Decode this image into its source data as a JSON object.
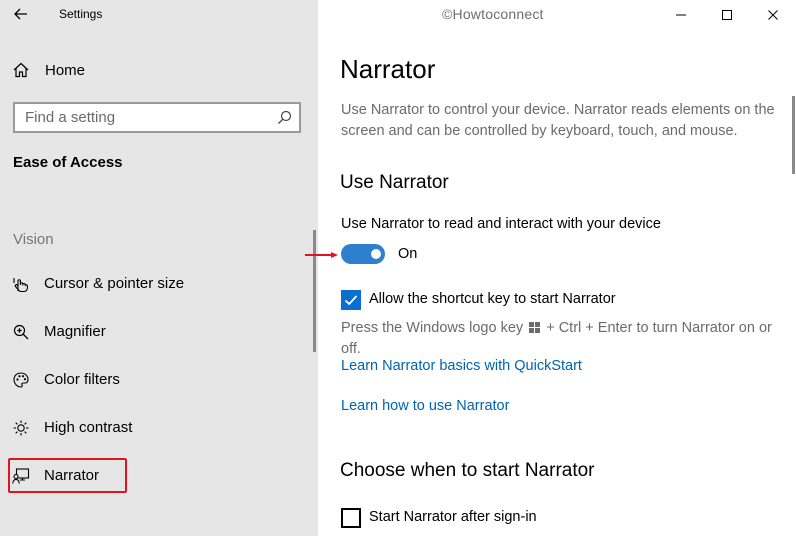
{
  "window": {
    "app_title": "Settings",
    "watermark": "©Howtoconnect"
  },
  "sidebar": {
    "home_label": "Home",
    "search_placeholder": "Find a setting",
    "section_title": "Ease of Access",
    "group_label": "Vision",
    "items": [
      {
        "label": "Cursor & pointer size",
        "icon": "cursor-pointer-icon"
      },
      {
        "label": "Magnifier",
        "icon": "magnifier-icon"
      },
      {
        "label": "Color filters",
        "icon": "palette-icon"
      },
      {
        "label": "High contrast",
        "icon": "brightness-icon"
      },
      {
        "label": "Narrator",
        "icon": "narrator-icon",
        "selected": true
      }
    ]
  },
  "main": {
    "title": "Narrator",
    "description": "Use Narrator to control your device. Narrator reads elements on the screen and can be controlled by keyboard, touch, and mouse.",
    "use_section": {
      "heading": "Use Narrator",
      "toggle_label": "Use Narrator to read and interact with your device",
      "toggle_state": "On",
      "toggle_on": true,
      "shortcut_checkbox_label": "Allow the shortcut key to start Narrator",
      "shortcut_checked": true,
      "hint_prefix": "Press the Windows logo key",
      "hint_suffix": "+ Ctrl + Enter to turn Narrator on or off.",
      "link_quickstart": "Learn Narrator basics with QuickStart",
      "link_howto": "Learn how to use Narrator"
    },
    "start_section": {
      "heading": "Choose when to start Narrator",
      "signin_checkbox_label": "Start Narrator after sign-in",
      "signin_checked": false
    }
  },
  "colors": {
    "accent": "#0063b1",
    "toggle_on": "#2f7fd0",
    "annotation_red": "#e0141e",
    "sidebar_bg": "#e6e6e6"
  }
}
